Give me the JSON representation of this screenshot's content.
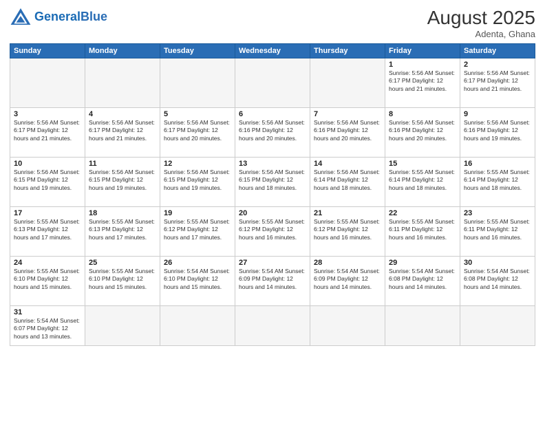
{
  "header": {
    "logo_general": "General",
    "logo_blue": "Blue",
    "month_year": "August 2025",
    "location": "Adenta, Ghana"
  },
  "weekdays": [
    "Sunday",
    "Monday",
    "Tuesday",
    "Wednesday",
    "Thursday",
    "Friday",
    "Saturday"
  ],
  "weeks": [
    [
      {
        "day": "",
        "info": ""
      },
      {
        "day": "",
        "info": ""
      },
      {
        "day": "",
        "info": ""
      },
      {
        "day": "",
        "info": ""
      },
      {
        "day": "",
        "info": ""
      },
      {
        "day": "1",
        "info": "Sunrise: 5:56 AM\nSunset: 6:17 PM\nDaylight: 12 hours\nand 21 minutes."
      },
      {
        "day": "2",
        "info": "Sunrise: 5:56 AM\nSunset: 6:17 PM\nDaylight: 12 hours\nand 21 minutes."
      }
    ],
    [
      {
        "day": "3",
        "info": "Sunrise: 5:56 AM\nSunset: 6:17 PM\nDaylight: 12 hours\nand 21 minutes."
      },
      {
        "day": "4",
        "info": "Sunrise: 5:56 AM\nSunset: 6:17 PM\nDaylight: 12 hours\nand 21 minutes."
      },
      {
        "day": "5",
        "info": "Sunrise: 5:56 AM\nSunset: 6:17 PM\nDaylight: 12 hours\nand 20 minutes."
      },
      {
        "day": "6",
        "info": "Sunrise: 5:56 AM\nSunset: 6:16 PM\nDaylight: 12 hours\nand 20 minutes."
      },
      {
        "day": "7",
        "info": "Sunrise: 5:56 AM\nSunset: 6:16 PM\nDaylight: 12 hours\nand 20 minutes."
      },
      {
        "day": "8",
        "info": "Sunrise: 5:56 AM\nSunset: 6:16 PM\nDaylight: 12 hours\nand 20 minutes."
      },
      {
        "day": "9",
        "info": "Sunrise: 5:56 AM\nSunset: 6:16 PM\nDaylight: 12 hours\nand 19 minutes."
      }
    ],
    [
      {
        "day": "10",
        "info": "Sunrise: 5:56 AM\nSunset: 6:15 PM\nDaylight: 12 hours\nand 19 minutes."
      },
      {
        "day": "11",
        "info": "Sunrise: 5:56 AM\nSunset: 6:15 PM\nDaylight: 12 hours\nand 19 minutes."
      },
      {
        "day": "12",
        "info": "Sunrise: 5:56 AM\nSunset: 6:15 PM\nDaylight: 12 hours\nand 19 minutes."
      },
      {
        "day": "13",
        "info": "Sunrise: 5:56 AM\nSunset: 6:15 PM\nDaylight: 12 hours\nand 18 minutes."
      },
      {
        "day": "14",
        "info": "Sunrise: 5:56 AM\nSunset: 6:14 PM\nDaylight: 12 hours\nand 18 minutes."
      },
      {
        "day": "15",
        "info": "Sunrise: 5:55 AM\nSunset: 6:14 PM\nDaylight: 12 hours\nand 18 minutes."
      },
      {
        "day": "16",
        "info": "Sunrise: 5:55 AM\nSunset: 6:14 PM\nDaylight: 12 hours\nand 18 minutes."
      }
    ],
    [
      {
        "day": "17",
        "info": "Sunrise: 5:55 AM\nSunset: 6:13 PM\nDaylight: 12 hours\nand 17 minutes."
      },
      {
        "day": "18",
        "info": "Sunrise: 5:55 AM\nSunset: 6:13 PM\nDaylight: 12 hours\nand 17 minutes."
      },
      {
        "day": "19",
        "info": "Sunrise: 5:55 AM\nSunset: 6:12 PM\nDaylight: 12 hours\nand 17 minutes."
      },
      {
        "day": "20",
        "info": "Sunrise: 5:55 AM\nSunset: 6:12 PM\nDaylight: 12 hours\nand 16 minutes."
      },
      {
        "day": "21",
        "info": "Sunrise: 5:55 AM\nSunset: 6:12 PM\nDaylight: 12 hours\nand 16 minutes."
      },
      {
        "day": "22",
        "info": "Sunrise: 5:55 AM\nSunset: 6:11 PM\nDaylight: 12 hours\nand 16 minutes."
      },
      {
        "day": "23",
        "info": "Sunrise: 5:55 AM\nSunset: 6:11 PM\nDaylight: 12 hours\nand 16 minutes."
      }
    ],
    [
      {
        "day": "24",
        "info": "Sunrise: 5:55 AM\nSunset: 6:10 PM\nDaylight: 12 hours\nand 15 minutes."
      },
      {
        "day": "25",
        "info": "Sunrise: 5:55 AM\nSunset: 6:10 PM\nDaylight: 12 hours\nand 15 minutes."
      },
      {
        "day": "26",
        "info": "Sunrise: 5:54 AM\nSunset: 6:10 PM\nDaylight: 12 hours\nand 15 minutes."
      },
      {
        "day": "27",
        "info": "Sunrise: 5:54 AM\nSunset: 6:09 PM\nDaylight: 12 hours\nand 14 minutes."
      },
      {
        "day": "28",
        "info": "Sunrise: 5:54 AM\nSunset: 6:09 PM\nDaylight: 12 hours\nand 14 minutes."
      },
      {
        "day": "29",
        "info": "Sunrise: 5:54 AM\nSunset: 6:08 PM\nDaylight: 12 hours\nand 14 minutes."
      },
      {
        "day": "30",
        "info": "Sunrise: 5:54 AM\nSunset: 6:08 PM\nDaylight: 12 hours\nand 14 minutes."
      }
    ],
    [
      {
        "day": "31",
        "info": "Sunrise: 5:54 AM\nSunset: 6:07 PM\nDaylight: 12 hours\nand 13 minutes."
      },
      {
        "day": "",
        "info": ""
      },
      {
        "day": "",
        "info": ""
      },
      {
        "day": "",
        "info": ""
      },
      {
        "day": "",
        "info": ""
      },
      {
        "day": "",
        "info": ""
      },
      {
        "day": "",
        "info": ""
      }
    ]
  ]
}
